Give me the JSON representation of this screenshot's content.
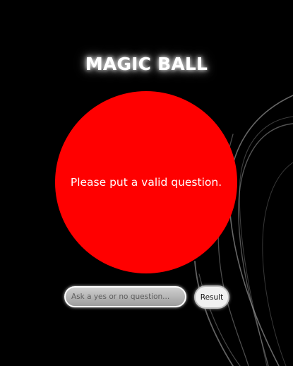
{
  "header": {
    "title": "MAGIC BALL"
  },
  "ball": {
    "message": "Please put a valid question.",
    "color": "#ff0000"
  },
  "form": {
    "question_placeholder": "Ask a yes or no question...",
    "question_value": "",
    "result_label": "Result"
  },
  "theme": {
    "background": "#000000",
    "text": "#ffffff"
  }
}
